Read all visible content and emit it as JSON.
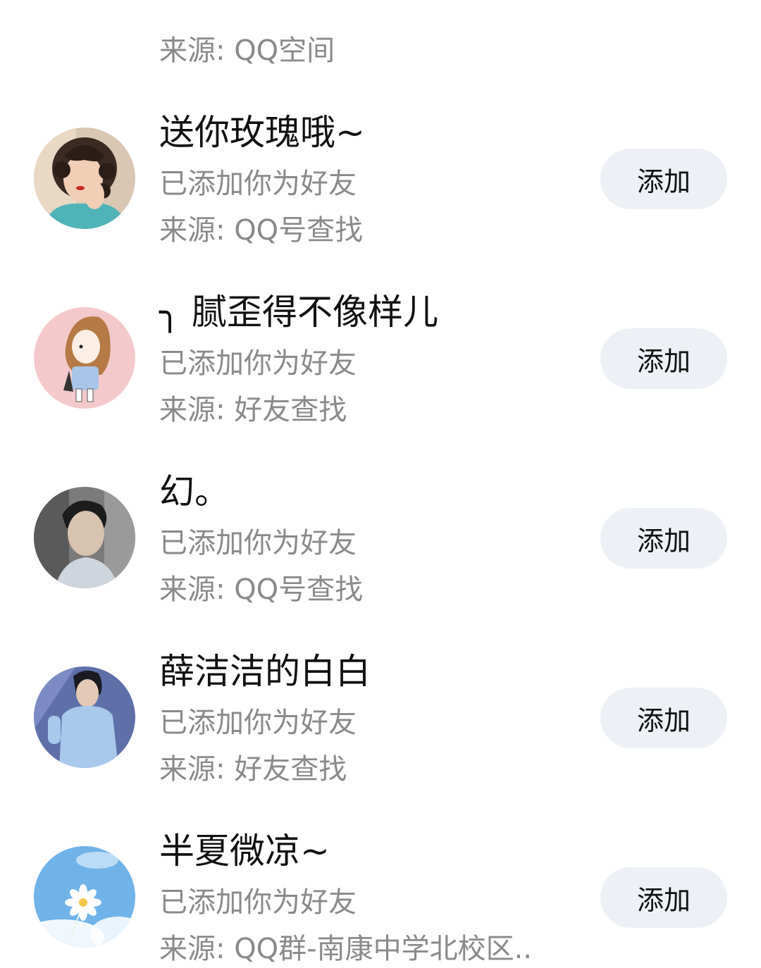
{
  "contacts": [
    {
      "name": "",
      "status": "",
      "source": "来源: QQ空间",
      "button": "",
      "avatar_icon": "partial-avatar"
    },
    {
      "name": "送你玫瑰哦~",
      "status": "已添加你为好友",
      "source": "来源: QQ号查找",
      "button": "添加",
      "avatar_icon": "girl-curly-hair-avatar"
    },
    {
      "name": "╮ 腻歪得不像样儿",
      "status": "已添加你为好友",
      "source": "来源: 好友查找",
      "button": "添加",
      "avatar_icon": "cartoon-girl-avatar"
    },
    {
      "name": "幻。",
      "status": "已添加你为好友",
      "source": "来源: QQ号查找",
      "button": "添加",
      "avatar_icon": "boy-portrait-avatar"
    },
    {
      "name": "薛洁洁的白白",
      "status": "已添加你为好友",
      "source": "来源: 好友查找",
      "button": "添加",
      "avatar_icon": "boy-tshirt-avatar"
    },
    {
      "name": "半夏微凉~",
      "status": "已添加你为好友",
      "source": "来源: QQ群-南康中学北校区..",
      "button": "添加",
      "avatar_icon": "flower-sky-avatar"
    }
  ],
  "colors": {
    "name": "#111111",
    "secondary": "#8a8a8a",
    "button_bg": "#edf0f4"
  }
}
